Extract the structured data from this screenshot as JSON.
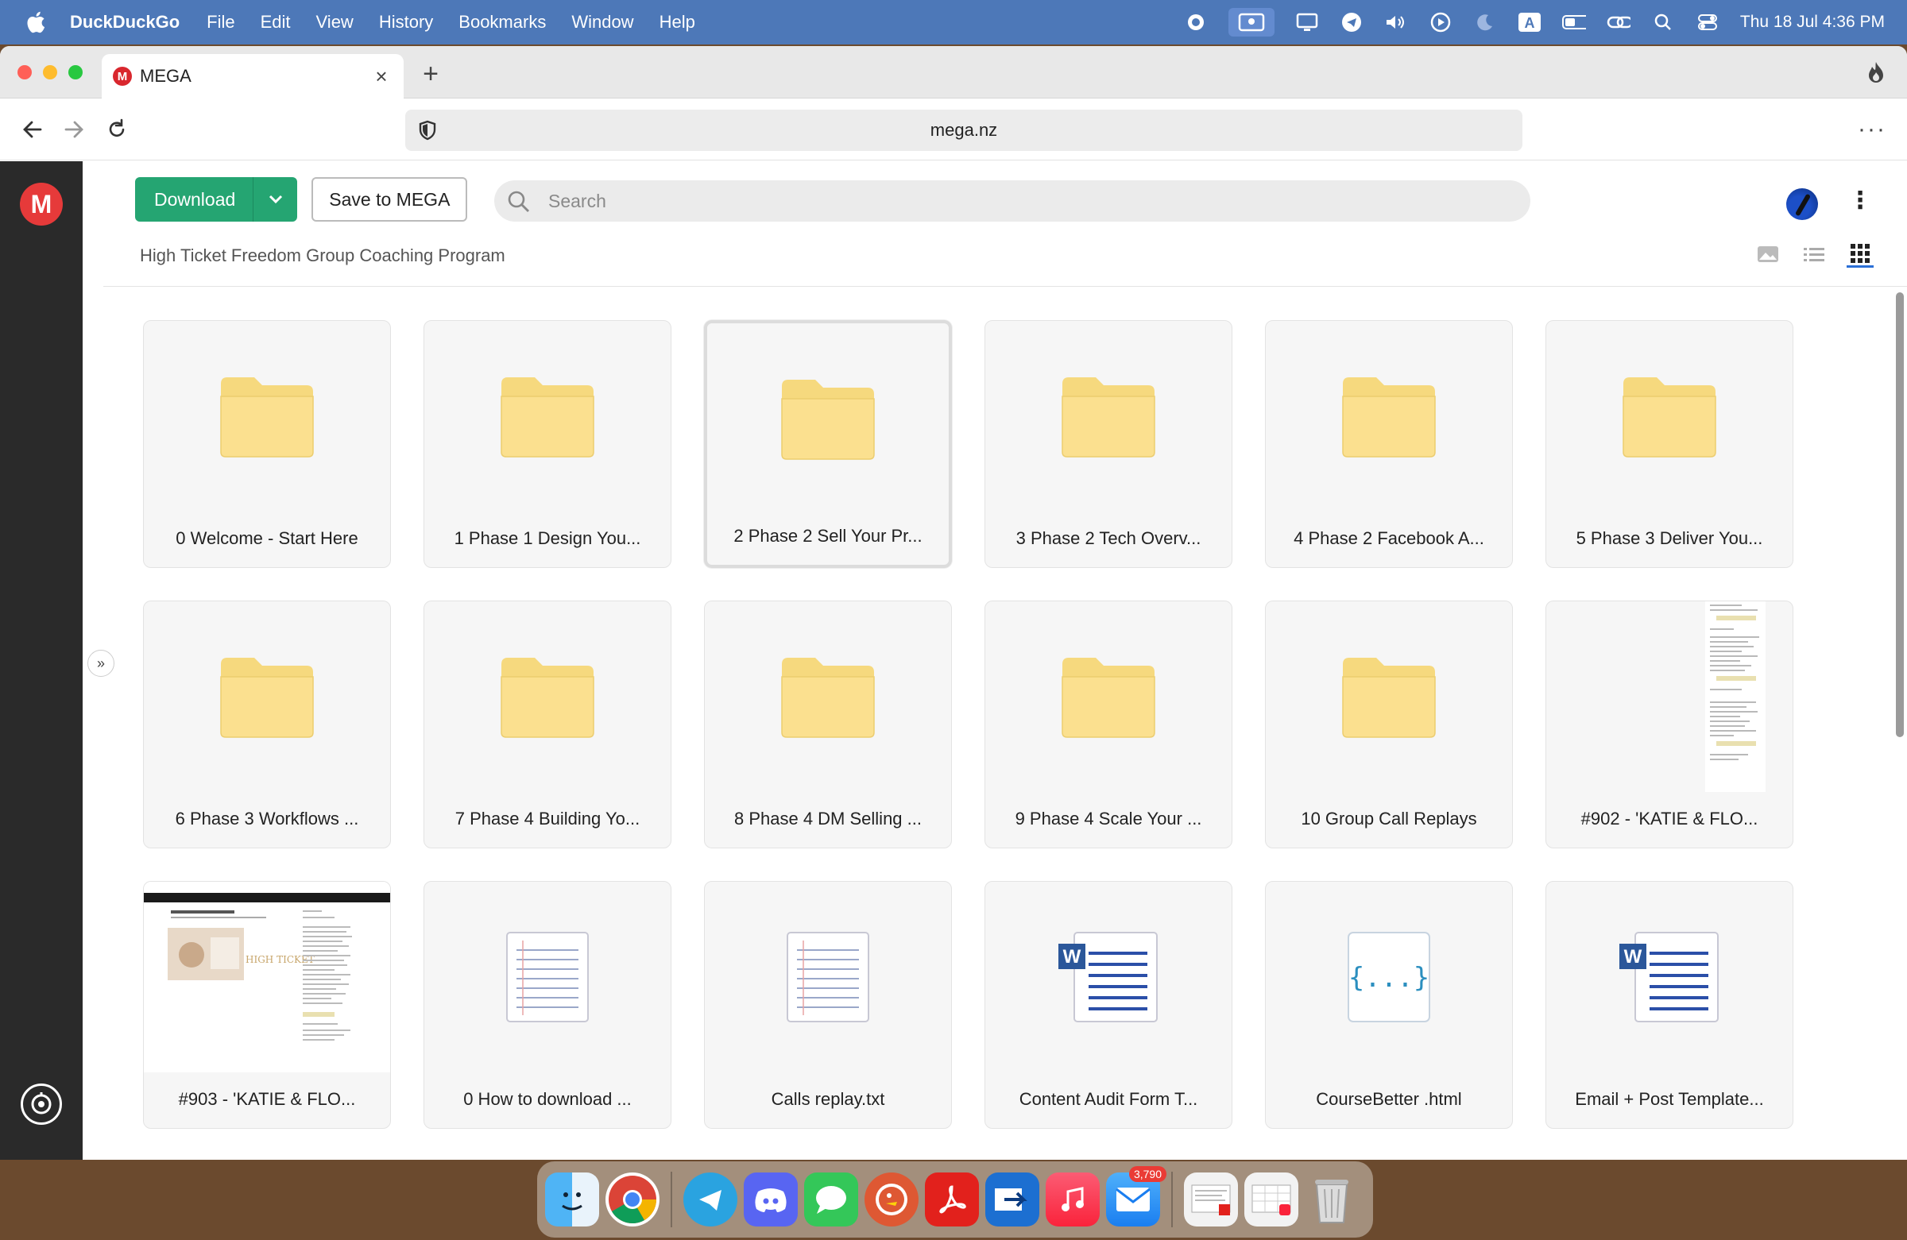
{
  "menubar": {
    "app_name": "DuckDuckGo",
    "items": [
      "File",
      "Edit",
      "View",
      "History",
      "Bookmarks",
      "Window",
      "Help"
    ],
    "clock": "Thu 18 Jul  4:36 PM"
  },
  "browser": {
    "tab_title": "MEGA",
    "tab_favicon": "M",
    "url": "mega.nz"
  },
  "mega": {
    "logo": "M",
    "download_label": "Download",
    "save_label": "Save to MEGA",
    "search_placeholder": "Search",
    "breadcrumb": "High Ticket Freedom Group Coaching Program",
    "items": [
      {
        "name": "0 Welcome - Start Here",
        "type": "folder"
      },
      {
        "name": "1 Phase 1 Design You...",
        "type": "folder"
      },
      {
        "name": "2 Phase 2 Sell Your Pr...",
        "type": "folder",
        "selected": true
      },
      {
        "name": "3 Phase 2 Tech Overv...",
        "type": "folder"
      },
      {
        "name": "4 Phase 2 Facebook A...",
        "type": "folder"
      },
      {
        "name": "5 Phase 3 Deliver You...",
        "type": "folder"
      },
      {
        "name": "6 Phase 3 Workflows ...",
        "type": "folder"
      },
      {
        "name": "7 Phase 4 Building Yo...",
        "type": "folder"
      },
      {
        "name": "8 Phase 4 DM Selling ...",
        "type": "folder"
      },
      {
        "name": "9 Phase 4 Scale Your ...",
        "type": "folder"
      },
      {
        "name": "10 Group Call Replays",
        "type": "folder"
      },
      {
        "name": "#902 - 'KATIE & FLO...",
        "type": "image-doc"
      },
      {
        "name": "#903 - 'KATIE & FLO...",
        "type": "image-screenshot"
      },
      {
        "name": "0 How to download ...",
        "type": "text"
      },
      {
        "name": "Calls replay.txt",
        "type": "text"
      },
      {
        "name": "Content Audit Form T...",
        "type": "word"
      },
      {
        "name": "CourseBetter .html",
        "type": "code"
      },
      {
        "name": "Email + Post Template...",
        "type": "word"
      }
    ]
  },
  "dock": {
    "mail_badge": "3,790"
  },
  "colors": {
    "menubar": "#4d78b8",
    "mega_red": "#e63a3a",
    "download_green": "#25a572",
    "folder_yellow": "#fbe08f"
  }
}
